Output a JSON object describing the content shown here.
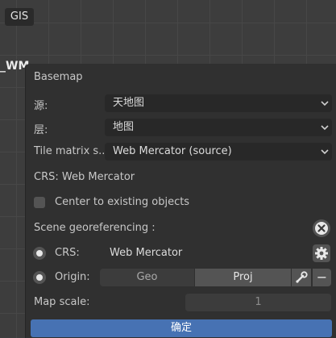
{
  "viewport": {
    "gis_button": "GIS",
    "object_label": "_WM"
  },
  "dialog": {
    "title": "Basemap",
    "source": {
      "label": "源:",
      "value": "天地图"
    },
    "layer": {
      "label": "层:",
      "value": "地图"
    },
    "tile_matrix": {
      "label": "Tile matrix s...",
      "value": "Web Mercator (source)"
    },
    "crs_info": "CRS: Web Mercator",
    "center_checkbox": {
      "label": "Center to existing objects",
      "checked": false
    },
    "scene_georef": {
      "label": "Scene georeferencing :"
    },
    "crs_row": {
      "label": "CRS:",
      "value": "Web Mercator"
    },
    "origin_row": {
      "label": "Origin:",
      "geo": "Geo",
      "proj": "Proj",
      "minus": "−"
    },
    "map_scale": {
      "label": "Map scale:",
      "value": "1"
    },
    "confirm": "确定"
  },
  "colors": {
    "panel_bg": "#303030",
    "field_bg": "#282828",
    "accent": "#4772b3"
  }
}
